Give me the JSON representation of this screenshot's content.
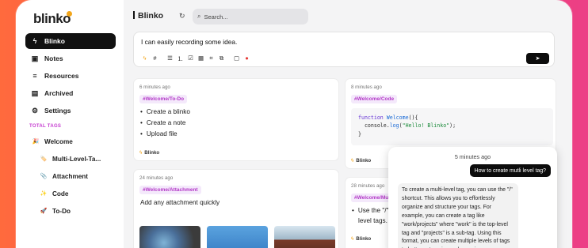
{
  "app": {
    "logo": "blinko"
  },
  "sidebar": {
    "items": [
      {
        "label": "Blinko",
        "icon": "bolt-icon"
      },
      {
        "label": "Notes",
        "icon": "notes-icon"
      },
      {
        "label": "Resources",
        "icon": "database-icon"
      },
      {
        "label": "Archived",
        "icon": "archive-icon"
      },
      {
        "label": "Settings",
        "icon": "gear-icon"
      }
    ],
    "tags_title": "TOTAL TAGS",
    "tags": [
      {
        "label": "Welcome",
        "emoji": "🎉"
      },
      {
        "label": "Multi-Level-Ta...",
        "emoji": "🏷️"
      },
      {
        "label": "Attachment",
        "emoji": "📎"
      },
      {
        "label": "Code",
        "emoji": "✨"
      },
      {
        "label": "To-Do",
        "emoji": "🚀"
      }
    ]
  },
  "header": {
    "title": "Blinko",
    "search_placeholder": "Search..."
  },
  "editor": {
    "text": "I can easily recording some idea."
  },
  "cards": {
    "todo": {
      "time": "6 minutes ago",
      "tag": "#Welcome/To-Do",
      "items": [
        "Create a blinko",
        "Create a note",
        "Upload file"
      ],
      "footer": "Blinko"
    },
    "code": {
      "time": "8 minutes ago",
      "tag": "#Welcome/Code",
      "footer": "Blinko"
    },
    "attachment": {
      "time": "24 minutes ago",
      "tag": "#Welcome/Attachment",
      "text": "Add any attachment quickly"
    },
    "multilevel": {
      "time": "28 minutes ago",
      "tag": "#Welcome/Mu",
      "line1": "Use the \"/\"",
      "line2": "level tags.",
      "footer": "Blinko"
    }
  },
  "chat": {
    "time": "5 minutes ago",
    "question": "How to create mutli level tag?",
    "answer": "To create a multi-level tag, you can use the \"/\" shortcut. This allows you to effortlessly organize and structure your tags. For example, you can create a tag like \"work/projects\" where \"work\" is the top-level tag and \"projects\" is a sub-tag. Using this format, you can create multiple levels of tags to better categorize and organize your"
  },
  "colors": {
    "accent": "#c53bd0",
    "bolt": "#f2a51a",
    "active_bg": "#111111"
  }
}
